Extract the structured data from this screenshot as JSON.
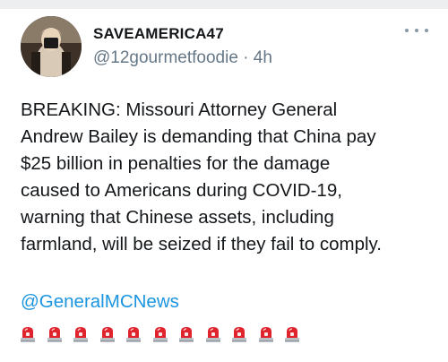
{
  "tweet": {
    "display_name": "SAVEAMERICA47",
    "meta": "@12gourmetfoodie · 4h",
    "body_lines": [
      "BREAKING: Missouri Attorney General",
      "Andrew Bailey is demanding that China pay",
      "$25 billion in penalties for the damage",
      "caused to Americans during COVID-19,",
      "warning that Chinese assets, including",
      "farmland, will be seized if they fail to comply."
    ],
    "mention": "@GeneralMCNews",
    "emoji_icon": "police-light-icon",
    "emoji_count": 11
  },
  "colors": {
    "link": "#1b95e0",
    "meta": "#657786",
    "siren_red": "#e0242e"
  }
}
